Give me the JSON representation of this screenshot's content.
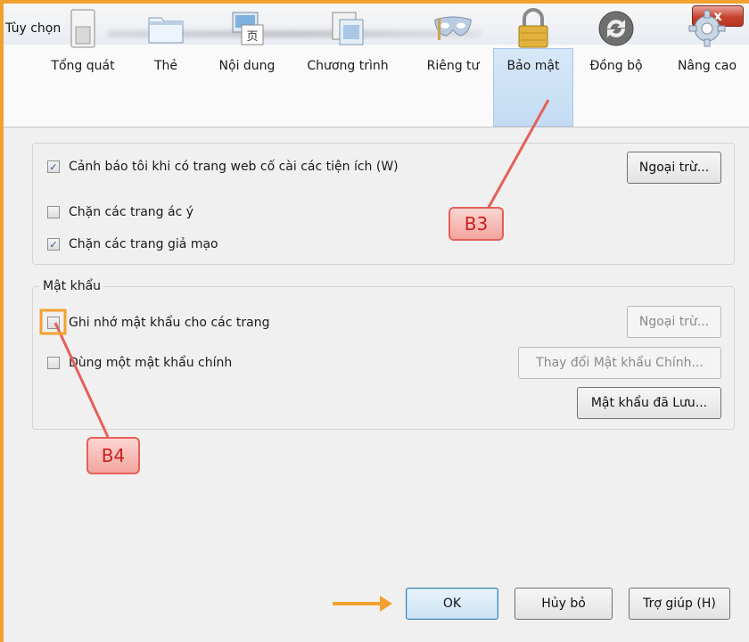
{
  "window": {
    "title": "Tùy chọn",
    "close_glyph": "x"
  },
  "toolbar": {
    "items": [
      {
        "label": "Tổng quát",
        "icon": "switch-icon",
        "selected": false
      },
      {
        "label": "Thẻ",
        "icon": "tabs-icon",
        "selected": false
      },
      {
        "label": "Nội dung",
        "icon": "content-icon",
        "selected": false
      },
      {
        "label": "Chương trình",
        "icon": "applications-icon",
        "selected": false
      },
      {
        "label": "Riêng tư",
        "icon": "mask-icon",
        "selected": false
      },
      {
        "label": "Bảo mật",
        "icon": "padlock-icon",
        "selected": true
      },
      {
        "label": "Đồng bộ",
        "icon": "sync-icon",
        "selected": false
      },
      {
        "label": "Nâng cao",
        "icon": "gear-icon",
        "selected": false
      }
    ]
  },
  "security": {
    "warn_addons": {
      "label": "Cảnh báo tôi khi có trang web cố cài các tiện ích (W)",
      "checked": true
    },
    "exceptions_button": "Ngoại trừ...",
    "block_attack": {
      "label": "Chặn các trang ác ý",
      "checked": false
    },
    "block_forgery": {
      "label": "Chặn các trang giả mạo",
      "checked": true
    }
  },
  "passwords": {
    "title": "Mật khẩu",
    "remember": {
      "label": "Ghi nhớ mật khẩu cho các trang",
      "checked": false
    },
    "remember_exceptions_button": "Ngoại trừ...",
    "master": {
      "label": "Dùng một mật khẩu chính",
      "checked": false
    },
    "change_master_button": "Thay đổi Mật khẩu Chính...",
    "saved_passwords_button": "Mật khẩu đã Lưu..."
  },
  "annotations": {
    "b3": "B3",
    "b4": "B4",
    "color": "#e5605a",
    "arrow_color": "#f2a130"
  },
  "footer": {
    "ok": "OK",
    "cancel": "Hủy bỏ",
    "help": "Trợ giúp (H)"
  },
  "colors": {
    "frame_accent": "#f2a130",
    "selected_tab": "#c3dcf3",
    "close_button": "#c6422f"
  }
}
